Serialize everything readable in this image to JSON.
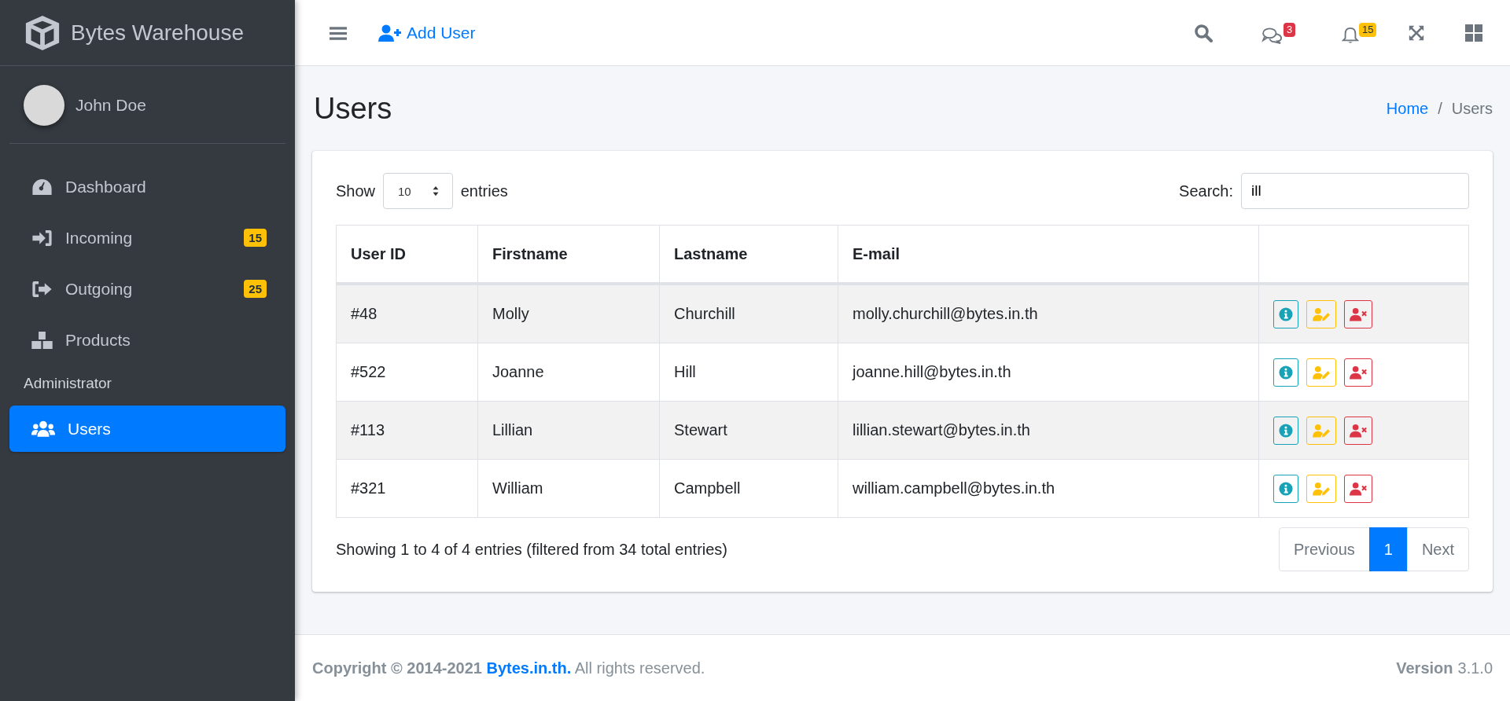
{
  "brand": {
    "name": "Bytes Warehouse"
  },
  "user": {
    "name": "John Doe"
  },
  "sidebar": {
    "items": [
      {
        "label": "Dashboard",
        "selected": false
      },
      {
        "label": "Incoming",
        "selected": false,
        "badge": "15"
      },
      {
        "label": "Outgoing",
        "selected": false,
        "badge": "25"
      },
      {
        "label": "Products",
        "selected": false
      }
    ],
    "section": "Administrator",
    "admin_items": [
      {
        "label": "Users",
        "selected": true
      }
    ]
  },
  "topbar": {
    "add_button": "Add User",
    "badges": [
      {
        "text": "3",
        "color": "#dc3545"
      },
      {
        "text": "15",
        "color": "#ffc107"
      }
    ]
  },
  "page": {
    "title": "Users",
    "breadcrumb": [
      {
        "label": "Home",
        "link": true
      },
      {
        "label": "/",
        "link": false
      },
      {
        "label": "Users",
        "link": false
      }
    ]
  },
  "table_controls": {
    "show_label": "Show",
    "page_size": "10",
    "entries_label": "entries",
    "search_label": "Search:",
    "search_value": "ill"
  },
  "table": {
    "columns": [
      "User ID",
      "Firstname",
      "Lastname",
      "E-mail"
    ],
    "rows": [
      [
        "#48",
        "Molly",
        "Churchill",
        "molly.churchill@bytes.in.th"
      ],
      [
        "#522",
        "Joanne",
        "Hill",
        "joanne.hill@bytes.in.th"
      ],
      [
        "#113",
        "Lillian",
        "Stewart",
        "lillian.stewart@bytes.in.th"
      ],
      [
        "#321",
        "William",
        "Campbell",
        "william.campbell@bytes.in.th"
      ]
    ]
  },
  "info": "Showing 1 to 4 of 4 entries (filtered from 34 total entries)",
  "pagination": [
    {
      "label": "Previous",
      "selected": false
    },
    {
      "label": "1",
      "selected": true
    },
    {
      "label": "Next",
      "selected": false
    }
  ],
  "footer": {
    "copyright": "**Copyright © 2014-2021** **Bytes.in.th.** All rights reserved.",
    "version_label": "Version",
    "version": "3.1.0"
  }
}
